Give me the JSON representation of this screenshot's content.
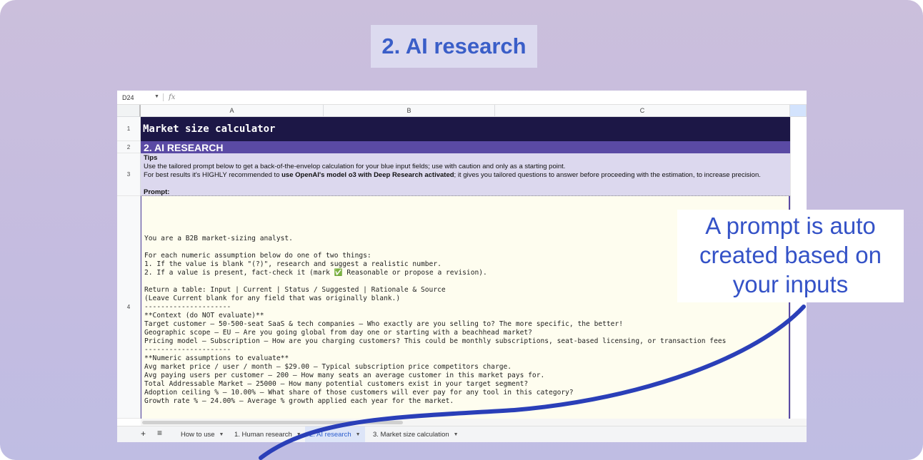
{
  "title_banner": "2. AI research",
  "callout": {
    "line1": "A prompt is auto",
    "line2": "created based on",
    "line3": "your inputs"
  },
  "sheet": {
    "cell_ref": "D24",
    "fx_label": "fx",
    "columns": [
      "A",
      "B",
      "C"
    ],
    "rows": [
      "1",
      "2",
      "3",
      "4"
    ],
    "row1_title": "Market size calculator",
    "row2_title": "2. AI RESEARCH",
    "tips": {
      "title": "Tips",
      "line1": "Use the tailored prompt below to get a back-of-the-envelop calculation for your blue input fields; use with caution and only as a starting point.",
      "line2_pre": "For best results it's HIGHLY recommended to ",
      "line2_bold": "use OpenAI's model o3 with Deep Research activated",
      "line2_post": "; it gives you tailored questions to answer before proceeding with the estimation, to increase precision.",
      "prompt_label": "Prompt:"
    },
    "prompt_lines": [
      "You are a B2B market-sizing analyst.",
      "",
      "For each numeric assumption below do one of two things:",
      "1. If the value is blank \"(?)\", research and suggest a realistic number.",
      "2. If a value is present, fact-check it (mark ✅ Reasonable or propose a revision).",
      "",
      "Return a table: Input | Current | Status / Suggested | Rationale & Source",
      "(Leave Current blank for any field that was originally blank.)",
      "---------------------",
      "**Context (do NOT evaluate)**",
      "Target customer – 50-500-seat SaaS & tech companies – Who exactly are you selling to? The more specific, the better!",
      "Geographic scope – EU – Are you going global from day one or starting with a beachhead market?",
      "Pricing model – Subscription – How are you charging customers? This could be monthly subscriptions, seat-based licensing, or transaction fees",
      "---------------------",
      "**Numeric assumptions to evaluate**",
      "Avg market price / user / month – $29.00 – Typical subscription price competitors charge.",
      "Avg paying users per customer – 200 – How many seats an average customer in this market pays for.",
      "Total Addressable Market – 25000 – How many potential customers exist in your target segment?",
      "Adoption ceiling % – 10.00% – What share of those customers will ever pay for any tool in this category?",
      "Growth rate % – 24.00% – Average % growth applied each year for the market."
    ],
    "tabs": [
      {
        "label": "How to use",
        "active": false
      },
      {
        "label": "1. Human research",
        "active": false
      },
      {
        "label": "2. AI research",
        "active": true
      },
      {
        "label": "3. Market size calculation",
        "active": false
      }
    ],
    "add_sheet": "+",
    "all_sheets": "≡"
  },
  "colors": {
    "banner_text": "#3a5ec8",
    "header_dark": "#1c1746",
    "header_purple": "#5a4aa4",
    "tips_bg": "#dcd8ee",
    "prompt_bg": "#fefdef",
    "arrow": "#2a3fb8"
  }
}
